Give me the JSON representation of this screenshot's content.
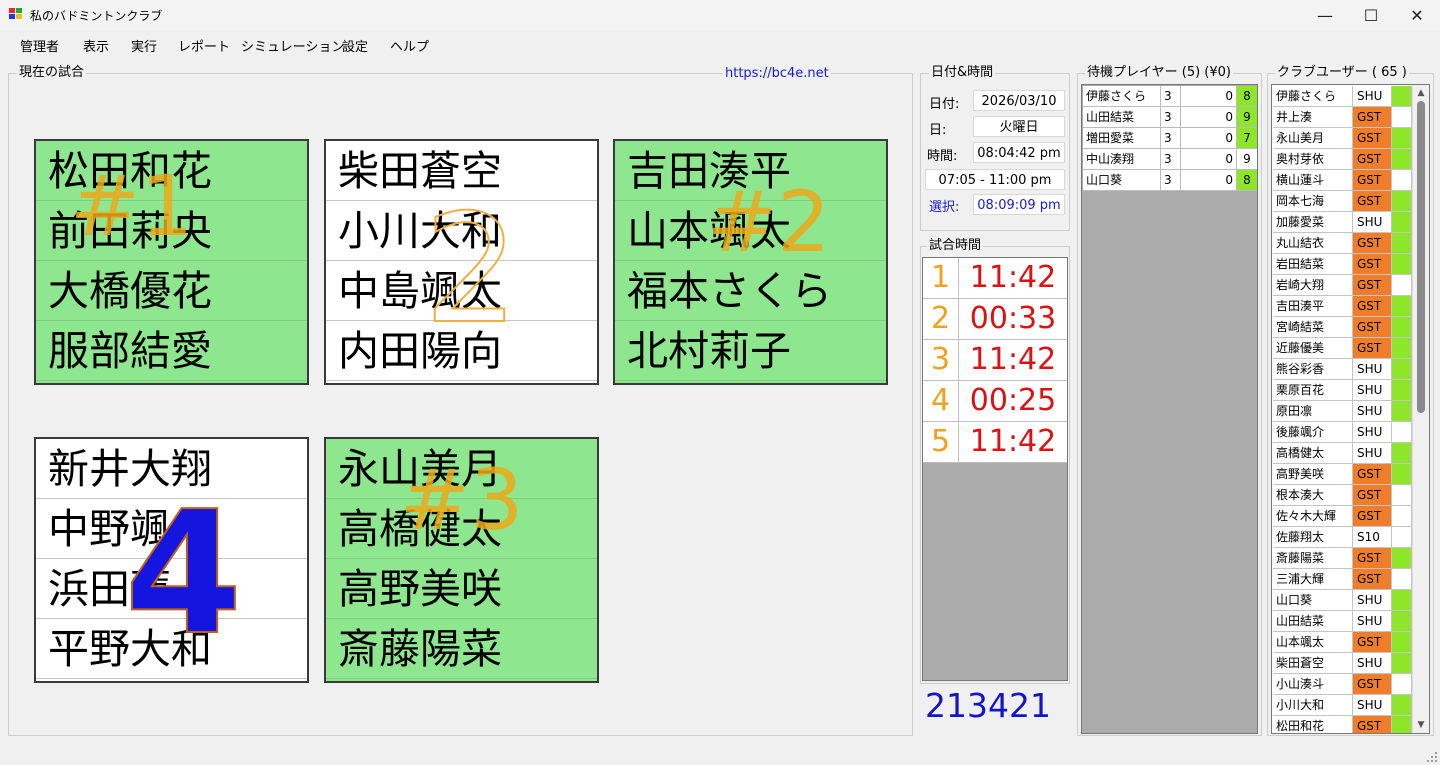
{
  "window": {
    "title": "私のバドミントンクラブ",
    "controls": {
      "minimize": "—",
      "maximize": "☐",
      "close": "✕"
    }
  },
  "menu": [
    "管理者",
    "表示",
    "実行",
    "レポート",
    "シミュレーション",
    "設定",
    "ヘルプ"
  ],
  "current_match": {
    "label": "現在の試合",
    "url": "https://bc4e.net",
    "courts": [
      {
        "number_label": "#1",
        "players": [
          "松田和花",
          "前田莉央",
          "大橋優花",
          "服部結愛"
        ]
      },
      {
        "number_label": "2",
        "players": [
          "柴田蒼空",
          "小川大和",
          "中島颯太",
          "内田陽向"
        ]
      },
      {
        "number_label": "#2",
        "players": [
          "吉田湊平",
          "山本颯太",
          "福本さくら",
          "北村莉子"
        ]
      },
      {
        "number_label": "4",
        "players": [
          "新井大翔",
          "中野颯人",
          "浜田蓮",
          "平野大和"
        ]
      },
      {
        "number_label": "#3",
        "players": [
          "永山美月",
          "高橋健太",
          "高野美咲",
          "斎藤陽菜"
        ]
      }
    ]
  },
  "datetime": {
    "label": "日付&時間",
    "date_label": "日付:",
    "date": "2026/03/10",
    "day_label": "日:",
    "day": "火曜日",
    "time_label": "時間:",
    "time": "08:04:42 pm",
    "hours": "07:05 - 11:00 pm",
    "select_label": "選択:",
    "select_time": "08:09:09 pm"
  },
  "match_time": {
    "label": "試合時間",
    "rows": [
      {
        "idx": "1",
        "time": "11:42"
      },
      {
        "idx": "2",
        "time": "00:33"
      },
      {
        "idx": "3",
        "time": "11:42"
      },
      {
        "idx": "4",
        "time": "00:25"
      },
      {
        "idx": "5",
        "time": "11:42"
      }
    ],
    "counter": "213421"
  },
  "waiting": {
    "label": "待機プレイヤー (5) (¥0)",
    "rows": [
      {
        "name": "伊藤さくら",
        "a": "3",
        "b": "0",
        "c": "8"
      },
      {
        "name": "山田結菜",
        "a": "3",
        "b": "0",
        "c": "9"
      },
      {
        "name": "増田愛菜",
        "a": "3",
        "b": "0",
        "c": "7"
      },
      {
        "name": "中山湊翔",
        "a": "3",
        "b": "0",
        "c": "9"
      },
      {
        "name": "山口葵",
        "a": "3",
        "b": "0",
        "c": "8"
      }
    ]
  },
  "club": {
    "label": "クラブユーザー ( 65 )",
    "rows": [
      {
        "name": "伊藤さくら",
        "type": "SHU",
        "on": true
      },
      {
        "name": "井上湊",
        "type": "GST",
        "on": false
      },
      {
        "name": "永山美月",
        "type": "GST",
        "on": true
      },
      {
        "name": "奥村芽依",
        "type": "GST",
        "on": true
      },
      {
        "name": "横山蓮斗",
        "type": "GST",
        "on": false
      },
      {
        "name": "岡本七海",
        "type": "GST",
        "on": true
      },
      {
        "name": "加藤愛菜",
        "type": "SHU",
        "on": true
      },
      {
        "name": "丸山結衣",
        "type": "GST",
        "on": true
      },
      {
        "name": "岩田結菜",
        "type": "GST",
        "on": true
      },
      {
        "name": "岩崎大翔",
        "type": "GST",
        "on": false
      },
      {
        "name": "吉田湊平",
        "type": "GST",
        "on": true
      },
      {
        "name": "宮崎結菜",
        "type": "GST",
        "on": true
      },
      {
        "name": "近藤優美",
        "type": "GST",
        "on": true
      },
      {
        "name": "熊谷彩香",
        "type": "SHU",
        "on": true
      },
      {
        "name": "栗原百花",
        "type": "SHU",
        "on": true
      },
      {
        "name": "原田凛",
        "type": "SHU",
        "on": true
      },
      {
        "name": "後藤颯介",
        "type": "SHU",
        "on": false
      },
      {
        "name": "高橋健太",
        "type": "SHU",
        "on": true
      },
      {
        "name": "高野美咲",
        "type": "GST",
        "on": true
      },
      {
        "name": "根本湊大",
        "type": "GST",
        "on": false
      },
      {
        "name": "佐々木大輝",
        "type": "GST",
        "on": false
      },
      {
        "name": "佐藤翔太",
        "type": "S10",
        "on": false
      },
      {
        "name": "斎藤陽菜",
        "type": "GST",
        "on": true
      },
      {
        "name": "三浦大輝",
        "type": "GST",
        "on": false
      },
      {
        "name": "山口葵",
        "type": "SHU",
        "on": true
      },
      {
        "name": "山田結菜",
        "type": "SHU",
        "on": true
      },
      {
        "name": "山本颯太",
        "type": "GST",
        "on": true
      },
      {
        "name": "柴田蒼空",
        "type": "SHU",
        "on": true
      },
      {
        "name": "小山湊斗",
        "type": "GST",
        "on": false
      },
      {
        "name": "小川大和",
        "type": "SHU",
        "on": true
      },
      {
        "name": "松田和花",
        "type": "GST",
        "on": true
      }
    ]
  },
  "colors": {
    "active_court": "#8ee68e",
    "gst": "#f07d2a",
    "green_cell": "#8ee62a",
    "timer_idx": "#eea21e",
    "timer_val": "#dd1111",
    "link": "#1a1ad8"
  }
}
